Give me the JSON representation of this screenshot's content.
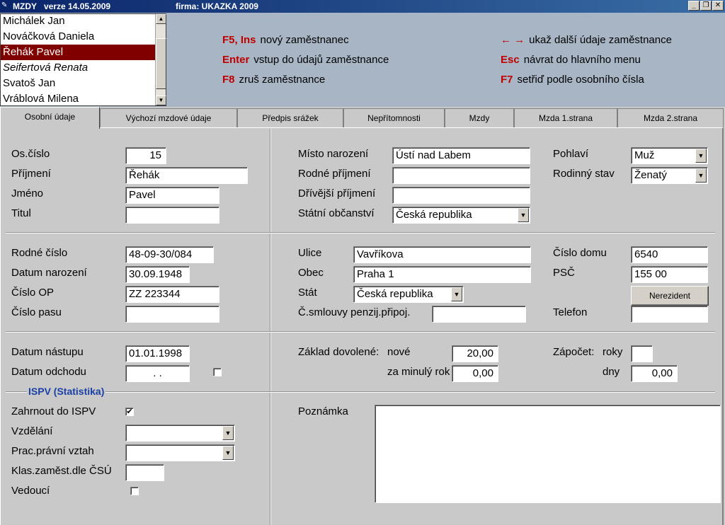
{
  "titlebar": {
    "app": "MZDY",
    "version": "verze 14.05.2009",
    "firm": "firma: UKAZKA 2009"
  },
  "employees": [
    {
      "name": "Michálek Jan",
      "selected": false,
      "italic": false
    },
    {
      "name": "Nováčková Daniela",
      "selected": false,
      "italic": false
    },
    {
      "name": "Řehák Pavel",
      "selected": true,
      "italic": false
    },
    {
      "name": "Seifertová Renata",
      "selected": false,
      "italic": true
    },
    {
      "name": "Svatoš Jan",
      "selected": false,
      "italic": false
    },
    {
      "name": "Vráblová Milena",
      "selected": false,
      "italic": false
    }
  ],
  "hotkeys": [
    {
      "key": "F5, Ins",
      "desc": "nový zaměstnanec"
    },
    {
      "key": "Enter",
      "desc": "vstup do údajů zaměstnance"
    },
    {
      "key": "F8",
      "desc": "zruš zaměstnance"
    },
    {
      "key": "← →",
      "desc": "ukaž další údaje zaměstnance"
    },
    {
      "key": "Esc",
      "desc": "návrat do hlavního menu"
    },
    {
      "key": "F7",
      "desc": "setřiď podle osobního čísla"
    }
  ],
  "tabs": [
    "Osobní údaje",
    "Výchozí mzdové údaje",
    "Předpis srážek",
    "Nepřítomnosti",
    "Mzdy",
    "Mzda 1.strana",
    "Mzda 2.strana"
  ],
  "s1": {
    "oscislo_label": "Os.číslo",
    "oscislo": "15",
    "prijmeni_label": "Příjmení",
    "prijmeni": "Řehák",
    "jmeno_label": "Jméno",
    "jmeno": "Pavel",
    "titul_label": "Titul",
    "titul": "",
    "misto_label": "Místo narození",
    "misto": "Ústí nad Labem",
    "rodne_prijmeni_label": "Rodné příjmení",
    "rodne_prijmeni": "",
    "drivejsi_label": "Dřívější příjmení",
    "drivejsi": "",
    "obcanstvi_label": "Státní občanství",
    "obcanstvi": "Česká republika",
    "pohlavi_label": "Pohlaví",
    "pohlavi": "Muž",
    "stav_label": "Rodinný stav",
    "stav": "Ženatý"
  },
  "s2": {
    "rc_label": "Rodné číslo",
    "rc": "48-09-30/084",
    "dn_label": "Datum narození",
    "dn": "30.09.1948",
    "op_label": "Číslo OP",
    "op": "ZZ 223344",
    "pas_label": "Číslo pasu",
    "pas": "",
    "ulice_label": "Ulice",
    "ulice": "Vavříkova",
    "obec_label": "Obec",
    "obec": "Praha 1",
    "stat_label": "Stát",
    "stat": "Česká republika",
    "smlouva_label": "Č.smlouvy penzij.připoj.",
    "smlouva": "",
    "domu_label": "Číslo domu",
    "domu": "6540",
    "psc_label": "PSČ",
    "psc": "155 00",
    "nerezident": "Nerezident",
    "tel_label": "Telefon",
    "tel": ""
  },
  "s3": {
    "nastup_label": "Datum nástupu",
    "nastup": "01.01.1998",
    "odchod_label": "Datum odchodu",
    "odchod": ". .",
    "zaklad_label": "Základ dovolené:",
    "nove_label": "nové",
    "nove": "20,00",
    "minuly_label": "za minulý rok",
    "minuly": "0,00",
    "zapocet_label": "Zápočet:",
    "roky_label": "roky",
    "roky": "",
    "dny_label": "dny",
    "dny": "0,00"
  },
  "s4": {
    "group": "ISPV (Statistika)",
    "ispv_label": "Zahrnout do ISPV",
    "ispv_checked": true,
    "vzdelani_label": "Vzdělání",
    "vzdelani": "",
    "vztah_label": "Prac.právní vztah",
    "vztah": "",
    "klas_label": "Klas.zaměst.dle ČSÚ",
    "klas": "",
    "vedouci_label": "Vedoucí",
    "vedouci_checked": false,
    "poznamka_label": "Poznámka",
    "poznamka": ""
  }
}
